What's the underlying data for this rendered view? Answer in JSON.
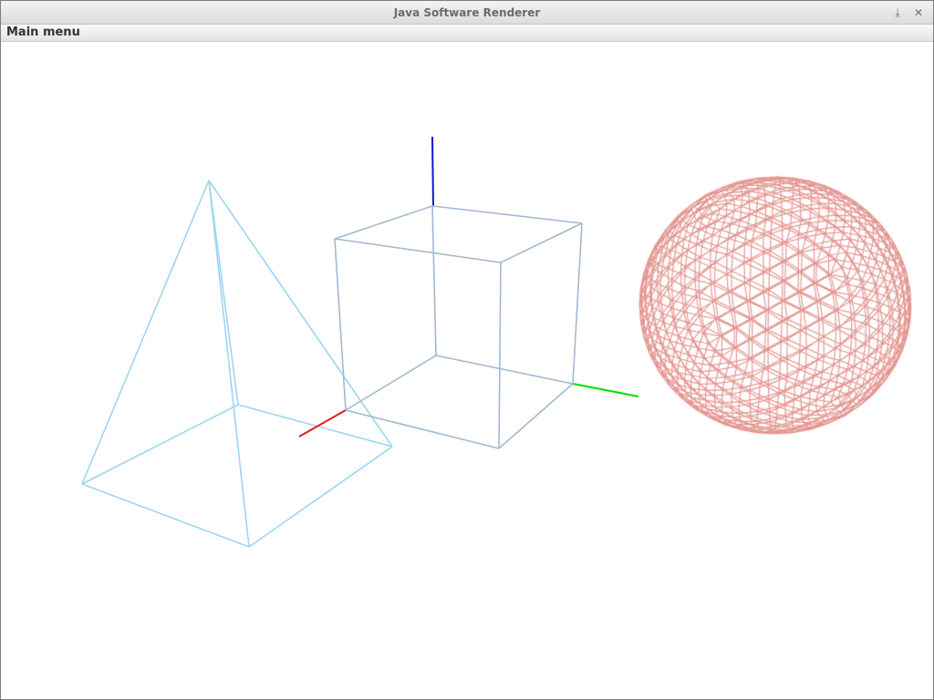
{
  "window": {
    "title": "Java Software Renderer",
    "minimize_glyph": "⤓",
    "close_glyph": "✕"
  },
  "menu": {
    "items": [
      {
        "label": "Main menu"
      }
    ]
  },
  "scene": {
    "objects": [
      {
        "name": "pyramid",
        "type": "wireframe-pyramid",
        "color": "#9dd6f1"
      },
      {
        "name": "cube",
        "type": "wireframe-cube",
        "color": "#a2b9d1"
      },
      {
        "name": "sphere",
        "type": "wireframe-sphere",
        "color": "#e49792"
      }
    ],
    "axes": {
      "x_color": "#e01c1c",
      "y_color": "#00e000",
      "z_color": "#1414d0"
    }
  }
}
